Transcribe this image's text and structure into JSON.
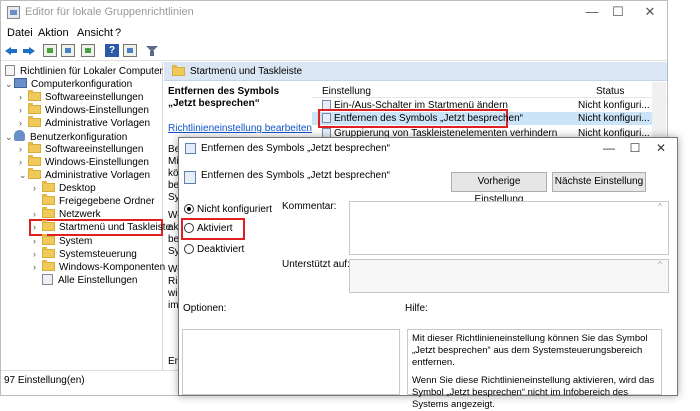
{
  "window": {
    "title": "Editor für lokale Gruppenrichtlinien",
    "minimize": "—",
    "maximize": "☐",
    "close": "✕"
  },
  "menu": [
    "Datei",
    "Aktion",
    "Ansicht",
    "?"
  ],
  "tree": {
    "root": "Richtlinien für Lokaler Computer",
    "items": [
      {
        "label": "Computerkonfiguration",
        "expander": "⌄"
      },
      {
        "label": "Softwareeinstellungen",
        "expander": "›"
      },
      {
        "label": "Windows-Einstellungen",
        "expander": "›"
      },
      {
        "label": "Administrative Vorlagen",
        "expander": "›"
      },
      {
        "label": "Benutzerkonfiguration",
        "expander": "⌄"
      },
      {
        "label": "Softwareeinstellungen",
        "expander": "›"
      },
      {
        "label": "Windows-Einstellungen",
        "expander": "›"
      },
      {
        "label": "Administrative Vorlagen",
        "expander": "⌄"
      },
      {
        "label": "Desktop",
        "expander": "›"
      },
      {
        "label": "Freigegebene Ordner",
        "expander": ""
      },
      {
        "label": "Netzwerk",
        "expander": "›"
      },
      {
        "label": "Startmenü und Taskleiste",
        "expander": "›"
      },
      {
        "label": "System",
        "expander": "›"
      },
      {
        "label": "Systemsteuerung",
        "expander": "›"
      },
      {
        "label": "Windows-Komponenten",
        "expander": "›"
      },
      {
        "label": "Alle Einstellungen",
        "expander": ""
      }
    ]
  },
  "pane": {
    "header": "Startmenü und Taskleiste",
    "desc_title": "Entfernen des Symbols „Jetzt besprechen“",
    "desc_link": "Richtlinieneinstellung bearbeiten",
    "desc_fragments": [
      "Bes",
      "Mi",
      "kö",
      "be",
      "Sys",
      "We",
      "akt",
      "be",
      "Sys",
      "We",
      "Ric",
      "wir",
      "im",
      "Er"
    ]
  },
  "list": {
    "col_setting": "Einstellung",
    "col_status": "Status",
    "rows": [
      {
        "name": "Ein-/Aus-Schalter im Startmenü ändern",
        "status": "Nicht konfiguri..."
      },
      {
        "name": "Entfernen des Symbols „Jetzt besprechen“",
        "status": "Nicht konfiguri..."
      },
      {
        "name": "Gruppierung von Taskleistenelementen verhindern",
        "status": "Nicht konfiguri..."
      }
    ]
  },
  "status_bar": "97 Einstellung(en)",
  "dialog": {
    "title": "Entfernen des Symbols „Jetzt besprechen“",
    "heading": "Entfernen des Symbols „Jetzt besprechen“",
    "btn_prev": "Vorherige Einstellung",
    "btn_next": "Nächste Einstellung",
    "radio_not_configured": "Nicht konfiguriert",
    "radio_enabled": "Aktiviert",
    "radio_disabled": "Deaktiviert",
    "selected_option": "Nicht konfiguriert",
    "label_comment": "Kommentar:",
    "label_supported": "Unterstützt auf:",
    "label_options": "Optionen:",
    "label_help": "Hilfe:",
    "help_p1": "Mit dieser Richtlinieneinstellung können Sie das Symbol „Jetzt besprechen“ aus dem Systemsteuerungsbereich entfernen.",
    "help_p2": "Wenn Sie diese Richtlinieneinstellung aktivieren, wird das Symbol „Jetzt besprechen“ nicht im Infobereich des Systems angezeigt."
  },
  "colors": {
    "highlight_red": "#e02020",
    "pane_header_bg": "#dbe6f4",
    "link": "#1155cc"
  }
}
